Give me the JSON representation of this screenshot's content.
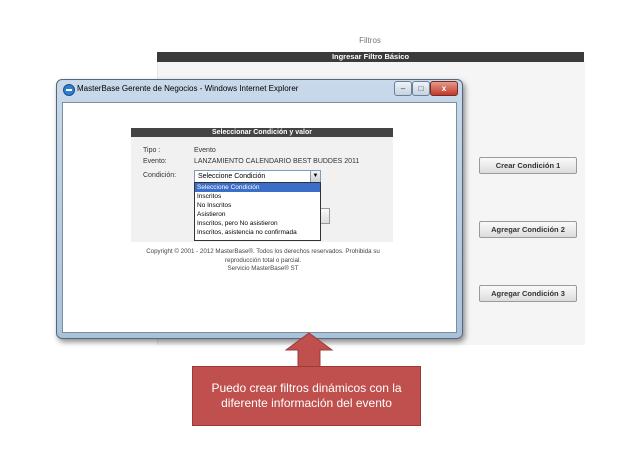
{
  "background": {
    "page_title": "Filtros",
    "bar_label": "Ingresar Filtro Básico",
    "buttons": [
      "Crear Condición 1",
      "Agregar Condición 2",
      "Agregar Condición 3"
    ]
  },
  "window": {
    "title": "MasterBase Gerente de Negocios - Windows Internet Explorer",
    "minimize": "–",
    "maximize": "□",
    "close": "x"
  },
  "dialog": {
    "header": "Seleccionar Condición y valor",
    "tipo_label": "Tipo :",
    "tipo_value": "Evento",
    "evento_label": "Evento:",
    "evento_value": "LANZAMIENTO CALENDARIO BEST BUDDES 2011",
    "condicion_label": "Condición:",
    "select_value": "Seleccione Condición",
    "options": [
      "Seleccione Condición",
      "Inscritos",
      "No Inscritos",
      "Asistieron",
      "Inscritos, pero No asistieron",
      "Inscritos, asistencia no confirmada"
    ],
    "selected_index": 0
  },
  "footer": {
    "line1": "Copyright © 2001 - 2012 MasterBase®. Todos los derechos reservados. Prohibida su",
    "line2": "reproducción total o parcial.",
    "line3": "Servicio MasterBase® ST"
  },
  "callout": {
    "text": "Puedo crear filtros dinámicos con la diferente información del evento",
    "color": "#c0504d"
  }
}
